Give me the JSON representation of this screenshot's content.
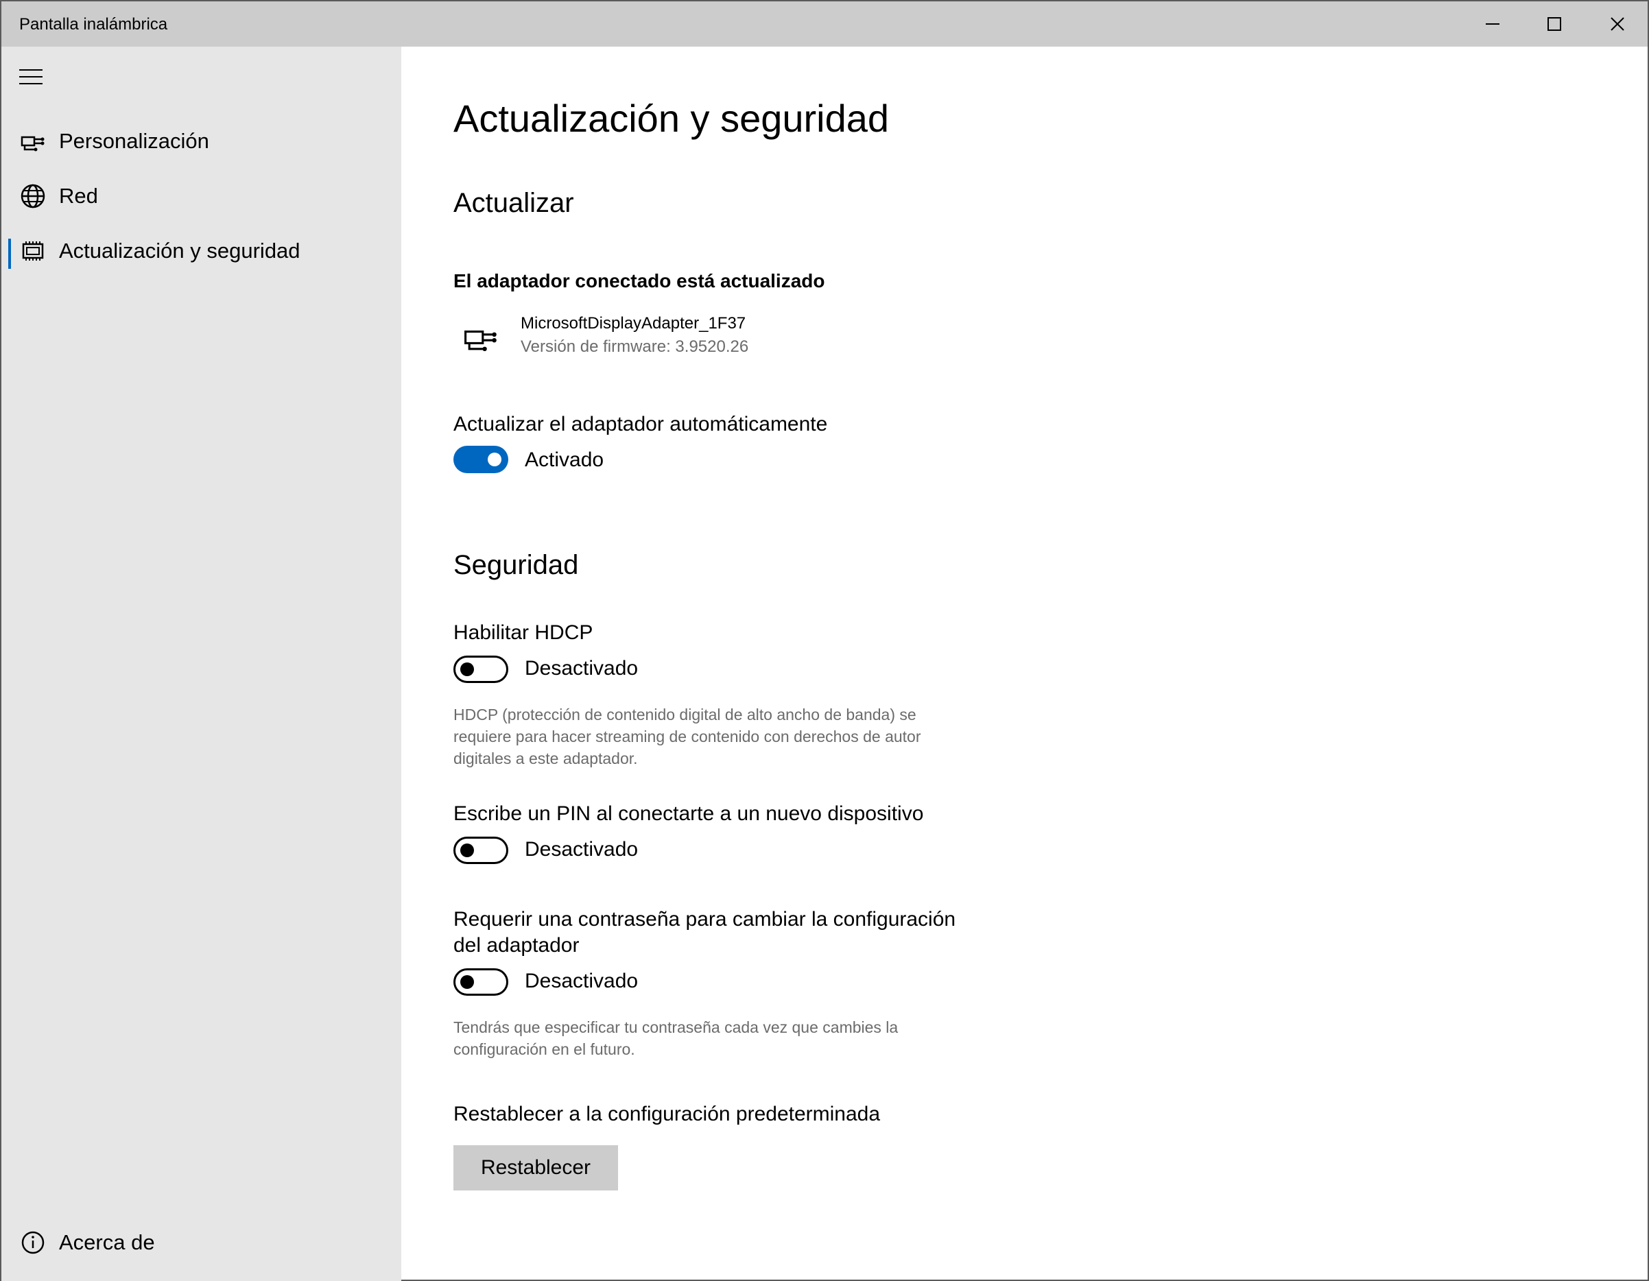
{
  "window": {
    "title": "Pantalla inalámbrica"
  },
  "sidebar": {
    "items": [
      {
        "label": "Personalización",
        "icon": "adapter-icon"
      },
      {
        "label": "Red",
        "icon": "globe-icon"
      },
      {
        "label": "Actualización y seguridad",
        "icon": "chip-icon",
        "selected": true
      }
    ],
    "about": {
      "label": "Acerca de",
      "icon": "info-icon"
    }
  },
  "main": {
    "page_title": "Actualización y seguridad",
    "update": {
      "heading": "Actualizar",
      "status": "El adaptador conectado está actualizado",
      "device_name": "MicrosoftDisplayAdapter_1F37",
      "firmware": "Versión de firmware: 3.9520.26",
      "auto_update_label": "Actualizar el adaptador automáticamente",
      "auto_update_state": "Activado"
    },
    "security": {
      "heading": "Seguridad",
      "hdcp_label": "Habilitar HDCP",
      "hdcp_state": "Desactivado",
      "hdcp_desc": "HDCP (protección de contenido digital de alto ancho de banda) se requiere para hacer streaming de contenido con derechos de autor digitales a este adaptador.",
      "pin_label": "Escribe un PIN al conectarte a un nuevo dispositivo",
      "pin_state": "Desactivado",
      "password_label_line1": "Requerir una contraseña para cambiar la configuración",
      "password_label_line2": "del adaptador",
      "password_state": "Desactivado",
      "password_desc": "Tendrás que especificar tu contraseña cada vez que cambies la configuración en el futuro.",
      "reset_label": "Restablecer a la configuración predeterminada",
      "reset_button": "Restablecer"
    }
  },
  "colors": {
    "accent": "#0067c0",
    "sidebar_bg": "#e6e6e6",
    "titlebar_bg": "#cccccc",
    "muted_text": "#6b6b6b"
  }
}
